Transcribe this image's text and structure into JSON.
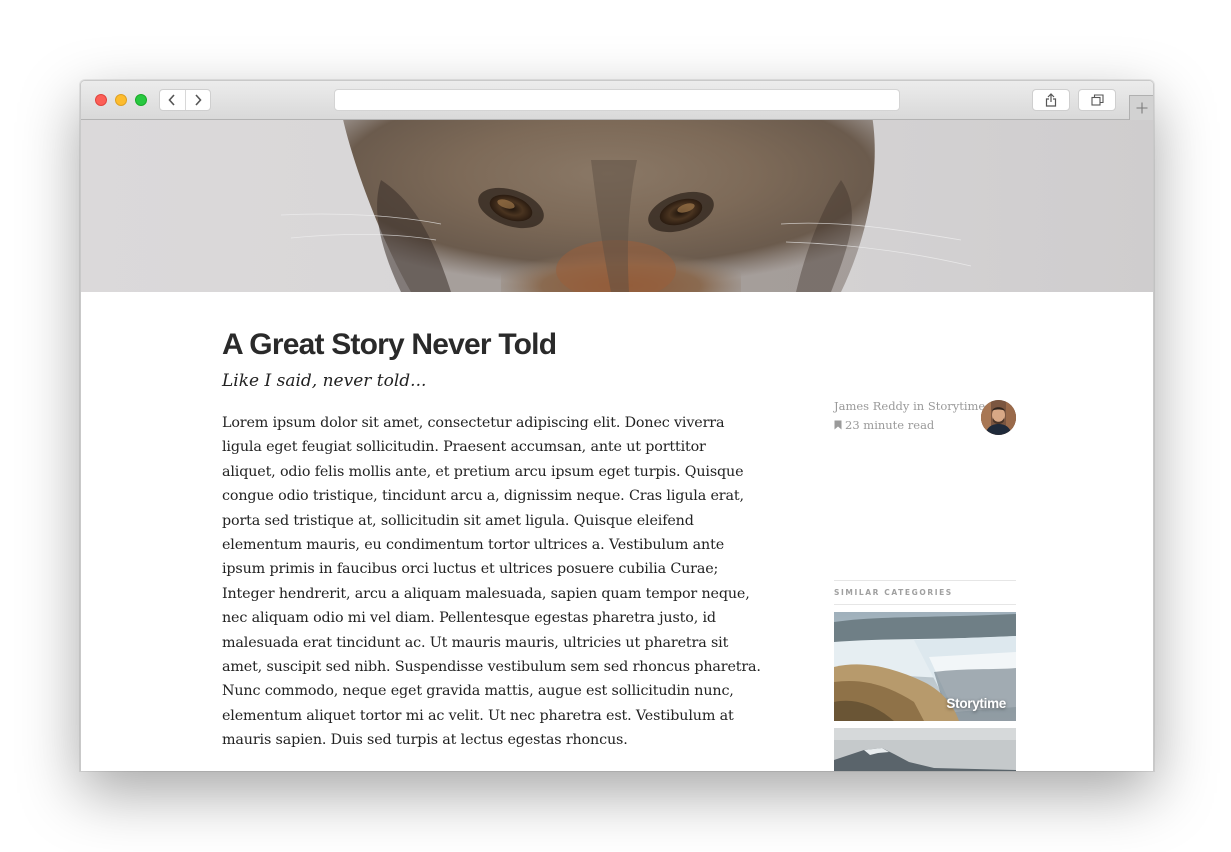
{
  "article": {
    "title": "A Great Story Never Told",
    "subtitle": "Like I said, never told...",
    "body": "Lorem ipsum dolor sit amet, consectetur adipiscing elit. Donec viverra ligula eget feugiat sollicitudin. Praesent accumsan, ante ut porttitor aliquet, odio felis mollis ante, et pretium arcu ipsum eget turpis. Quisque congue odio tristique, tincidunt arcu a, dignissim neque. Cras ligula erat, porta sed tristique at, sollicitudin sit amet ligula. Quisque eleifend elementum mauris, eu condimentum tortor ultrices a. Vestibulum ante ipsum primis in faucibus orci luctus et ultrices posuere cubilia Curae; Integer hendrerit, arcu a aliquam malesuada, sapien quam tempor neque, nec aliquam odio mi vel diam. Pellentesque egestas pharetra justo, id malesuada erat tincidunt ac. Ut mauris mauris, ultricies ut pharetra sit amet, suscipit sed nibh. Suspendisse vestibulum sem sed rhoncus pharetra. Nunc commodo, neque eget gravida mattis, augue est sollicitudin nunc, elementum aliquet tortor mi ac velit. Ut nec pharetra est. Vestibulum at mauris sapien. Duis sed turpis at lectus egestas rhoncus."
  },
  "meta": {
    "author_line": "James Reddy in Storytime",
    "read_time": "23 minute read"
  },
  "sidebar": {
    "similar_header": "SIMILAR CATEGORIES",
    "cards": [
      {
        "label": "Storytime"
      },
      {
        "label": ""
      }
    ]
  },
  "browser": {
    "url": ""
  },
  "icons": {
    "back": "chevron-left-icon",
    "forward": "chevron-right-icon",
    "share": "share-icon",
    "tabs": "tabs-icon",
    "new_tab": "plus-icon",
    "read_time": "bookmark-icon"
  }
}
